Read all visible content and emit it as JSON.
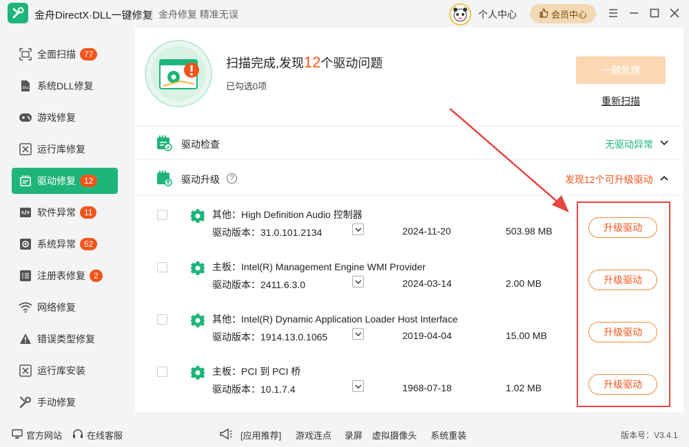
{
  "app": {
    "title": "金舟DirectX·DLL一键修复",
    "slogan": "金舟修复 精准无误",
    "personal_center": "个人中心",
    "vip_center": "会员中心",
    "version": "版本号：V3.4.1"
  },
  "sidebar": {
    "items": [
      {
        "label": "全面扫描",
        "badge": "77",
        "icon": "scan-icon"
      },
      {
        "label": "系统DLL修复",
        "badge": "",
        "icon": "dll-icon"
      },
      {
        "label": "游戏修复",
        "badge": "",
        "icon": "gamepad-icon"
      },
      {
        "label": "运行库修复",
        "badge": "",
        "icon": "runtime-icon"
      },
      {
        "label": "驱动修复",
        "badge": "12",
        "icon": "driver-icon"
      },
      {
        "label": "软件异常",
        "badge": "11",
        "icon": "code-icon"
      },
      {
        "label": "系统异常",
        "badge": "52",
        "icon": "system-gear-icon"
      },
      {
        "label": "注册表修复",
        "badge": "2",
        "icon": "registry-icon"
      },
      {
        "label": "网络修复",
        "badge": "",
        "icon": "wifi-icon"
      },
      {
        "label": "错误类型修复",
        "badge": "",
        "icon": "warning-icon"
      },
      {
        "label": "运行库安装",
        "badge": "",
        "icon": "runtime-install-icon"
      },
      {
        "label": "手动修复",
        "badge": "",
        "icon": "wrench-icon"
      }
    ]
  },
  "summary": {
    "title_prefix": "扫描完成,发现",
    "count": "12",
    "title_suffix": "个驱动问题",
    "selected": "已勾选0项",
    "onekey_button": "一键处理",
    "rescan_link": "重新扫描"
  },
  "sections": {
    "check": {
      "title": "驱动检查",
      "status": "无驱动异常"
    },
    "upgrade": {
      "title": "驱动升级",
      "status": "发现12个可升级驱动"
    }
  },
  "drivers": [
    {
      "name": "其他：High Definition Audio 控制器",
      "version": "驱动版本：31.0.101.2134",
      "date": "2024-11-20",
      "size": "503.98 MB",
      "button": "升级驱动"
    },
    {
      "name": "主板：Intel(R) Management Engine WMI Provider",
      "version": "驱动版本：2411.6.3.0",
      "date": "2024-03-14",
      "size": "2.00 MB",
      "button": "升级驱动"
    },
    {
      "name": "其他：Intel(R) Dynamic Application Loader Host Interface",
      "version": "驱动版本：1914.13.0.1065",
      "date": "2019-04-04",
      "size": "15.00 MB",
      "button": "升级驱动"
    },
    {
      "name": "主板：PCI 到 PCI 桥",
      "version": "驱动版本：10.1.7.4",
      "date": "1968-07-18",
      "size": "1.02 MB",
      "button": "升级驱动"
    }
  ],
  "footer": {
    "website": "官方网站",
    "support": "在线客服",
    "recommend": "[应用推荐]",
    "links": [
      "游戏连点",
      "录屏",
      "虚拟摄像头",
      "系统重装"
    ]
  },
  "colors": {
    "brand_green": "#1fb57a",
    "accent_orange": "#f2541b",
    "annotation_red": "#e5463f"
  }
}
